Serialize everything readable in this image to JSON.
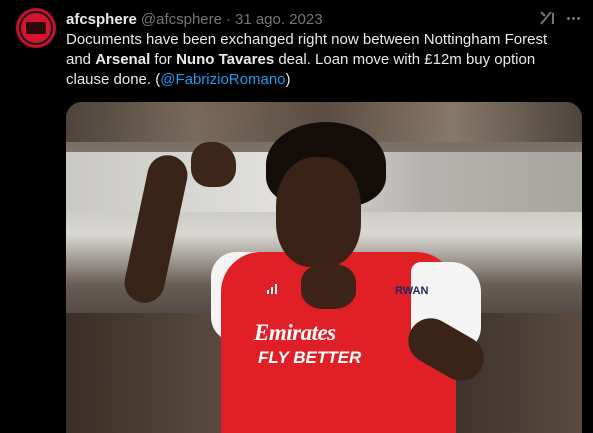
{
  "tweet": {
    "author_name": "afcsphere",
    "author_handle": "@afcsphere",
    "separator": "·",
    "date": "31 ago. 2023",
    "text_parts": {
      "p1": "Documents have been exchanged right now between Nottingham Forest and ",
      "b1": "Arsenal",
      "p2": " for ",
      "b2": "Nuno Tavares",
      "p3": " deal.  Loan move with £12m buy option clause done. (",
      "mention": "@FabrizioRomano",
      "p4": ")"
    }
  },
  "media": {
    "sponsor_line1": "Emirates",
    "sponsor_line2": "FLY BETTER",
    "kit_text": "RWAN"
  },
  "icons": {
    "grok": "grok-icon",
    "more": "more-icon",
    "avatar": "avatar"
  },
  "colors": {
    "background": "#000000",
    "link": "#1d9bf0",
    "muted": "#71767b",
    "text": "#e7e9ea"
  }
}
